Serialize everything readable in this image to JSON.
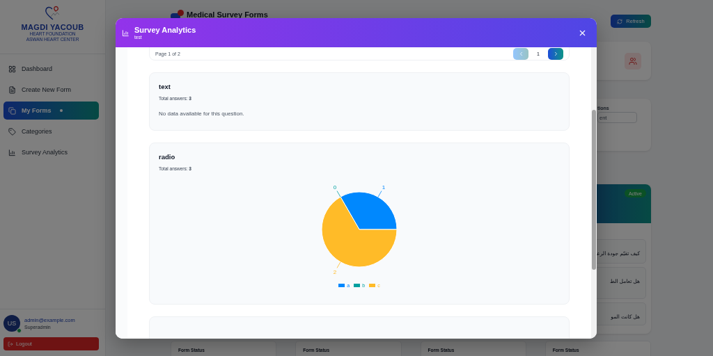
{
  "sidebar": {
    "logo": {
      "name": "MAGDI YACOUB",
      "line_1": "HEART FOUNDATION",
      "line_2": "ASWAN HEART CENTER"
    },
    "items": [
      {
        "label": "Dashboard",
        "selected": false
      },
      {
        "label": "Create New Form",
        "selected": false
      },
      {
        "label": "My Forms",
        "selected": true
      },
      {
        "label": "Categories",
        "selected": false
      },
      {
        "label": "Survey Analytics",
        "selected": false
      }
    ],
    "user": {
      "initials": "US",
      "email": "admin@example.com",
      "role": "Superadmin",
      "online": true
    },
    "logout": "Logout"
  },
  "header": {
    "title": "Medical Survey Forms",
    "refresh": "Refresh"
  },
  "filters": {
    "label": "tions",
    "placeholder": "ent"
  },
  "form_card": {
    "badge": "Active",
    "questions": [
      "كيف تقيّم جودة الرعا",
      "هل تعامل الط",
      "هل كانت المو"
    ]
  },
  "form_status_cards": [
    "Form Status",
    "Form Status",
    "Form Status",
    "Form Status"
  ],
  "modal": {
    "title": "Survey Analytics",
    "subtitle": "test",
    "pagination": {
      "text": "Page 1 of 2",
      "page": "1",
      "prev_disabled": true
    },
    "questions": [
      {
        "kind": "empty",
        "title": "text",
        "total": "Total answers: **3**",
        "message": "No data available for this question."
      },
      {
        "kind": "chart",
        "title": "radio",
        "total": "Total answers: **3**",
        "chart_data": {
          "type": "pie",
          "categories": [
            "a",
            "b",
            "c"
          ],
          "values": [
            1,
            0,
            2
          ],
          "colors": [
            "#0088fe",
            "#00a0a0",
            "#ffbb28"
          ],
          "value_labels": [
            "1",
            "0",
            "2"
          ]
        }
      },
      {
        "kind": "cut"
      }
    ]
  }
}
